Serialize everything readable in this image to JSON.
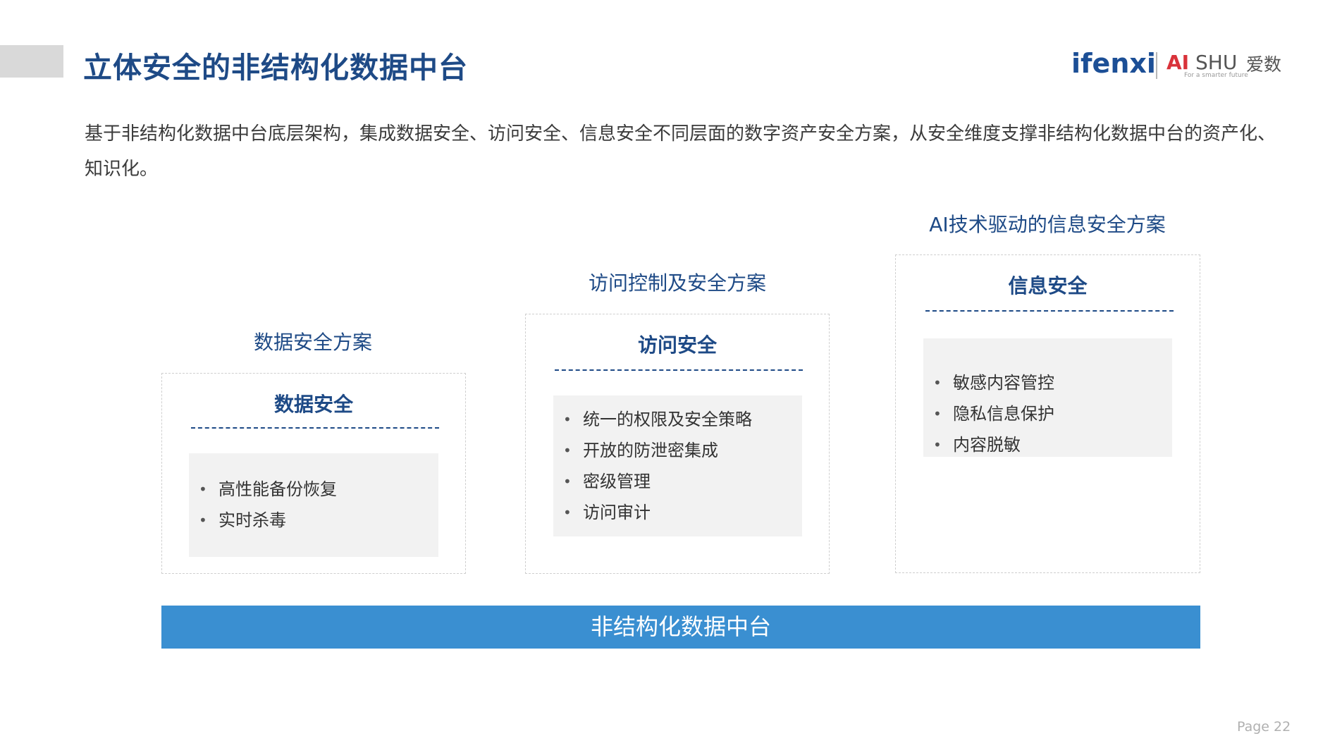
{
  "header": {
    "title": "立体安全的非结构化数据中台",
    "logo": {
      "ifenxi": "ifenxi",
      "brand_ai": "AI",
      "brand_shu": "SHU",
      "brand_cn": "爱数",
      "tagline": "For a smarter future"
    }
  },
  "description": "基于非结构化数据中台底层架构，集成数据安全、访问安全、信息安全不同层面的数字资产安全方案，从安全维度支撑非结构化数据中台的资产化、知识化。",
  "columns": [
    {
      "scheme": "数据安全方案",
      "title": "数据安全",
      "items": [
        "高性能备份恢复",
        "实时杀毒"
      ]
    },
    {
      "scheme": "访问控制及安全方案",
      "title": "访问安全",
      "items": [
        "统一的权限及安全策略",
        "开放的防泄密集成",
        "密级管理",
        "访问审计"
      ]
    },
    {
      "scheme": "AI技术驱动的信息安全方案",
      "title": "信息安全",
      "items": [
        "敏感内容管控",
        "隐私信息保护",
        "内容脱敏"
      ]
    }
  ],
  "base_platform": "非结构化数据中台",
  "footer": {
    "page": "Page  22"
  },
  "colors": {
    "title": "#1e4a86",
    "base_bar": "#3a8fd1",
    "box_bg": "#f2f2f2"
  }
}
